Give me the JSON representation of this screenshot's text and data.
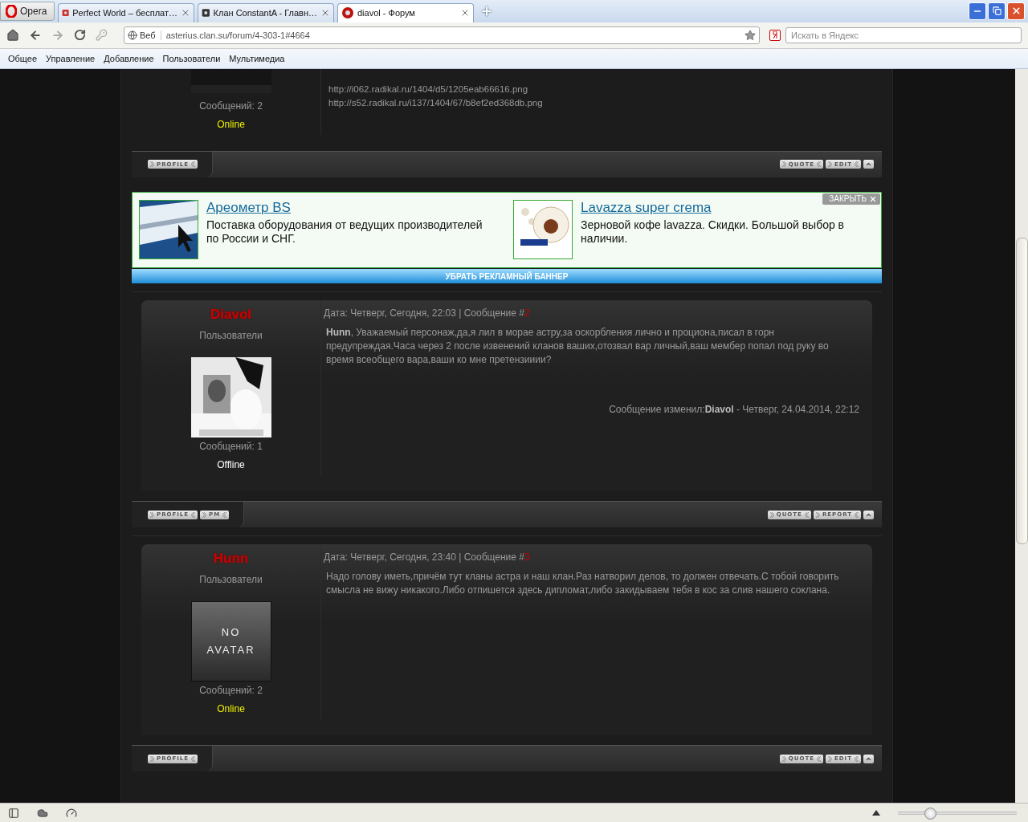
{
  "browser": {
    "opera_label": "Opera",
    "tabs": [
      {
        "title": "Perfect World – бесплат…",
        "selected": false,
        "kind": "game"
      },
      {
        "title": "Клан ConstantA - Главн…",
        "selected": false,
        "kind": "clan"
      },
      {
        "title": "diavol - Форум",
        "selected": true,
        "kind": "forum"
      }
    ],
    "address": {
      "badge": "Веб",
      "url": "asterius.clan.su/forum/4-303-1#4664"
    },
    "search": {
      "placeholder": "Искать в Яндекс"
    },
    "bookmarks": [
      "Общее",
      "Управление",
      "Добавление",
      "Пользователи",
      "Мультимедиа"
    ]
  },
  "posts": [
    {
      "kind": "partial",
      "count": "Сообщений: 2",
      "status": "Online",
      "online": true,
      "lines": [
        "http://i062.radikal.ru/1404/d5/1205eab66616.png",
        "http://s52.radikal.ru/i137/1404/67/b8ef2ed368db.png"
      ],
      "footer_left": [
        "PROFILE"
      ],
      "footer_right": [
        "QUOTE",
        "EDIT"
      ]
    },
    {
      "kind": "full",
      "author": "Diavol",
      "group": "Пользователи",
      "count": "Сообщений: 1",
      "status": "Offline",
      "online": false,
      "date": "Дата: Четверг, Сегодня, 22:03 | Сообщение #",
      "number": "2",
      "body": "**Hunn**, Уважаемый персонаж,да,я лил в морае астру,за оскорбления лично и проциона,писал в горн предупреждая.Часа через 2 после извенений кланов ваших,отозвал вар личный,ваш мембер попал под руку во время всеобщего вара,ваши ко мне претензииии?",
      "edit_note": "Сообщение изменил:**Diavol** - Четверг, 24.04.2014, 22:12",
      "footer_left": [
        "PROFILE",
        "PM"
      ],
      "footer_right": [
        "QUOTE",
        "REPORT"
      ]
    },
    {
      "kind": "full",
      "author": "Hunn",
      "group": "Пользователи",
      "avatar_label": "NO AVATAR",
      "count": "Сообщений: 2",
      "status": "Online",
      "online": true,
      "date": "Дата: Четверг, Сегодня, 23:40 | Сообщение #",
      "number": "3",
      "body": "Надо голову иметь,причём тут кланы астра и наш клан.Раз натворил делов, то должен отвечать.С тобой говорить смысла не вижу никакого.Либо отпишется здесь дипломат,либо закидываем тебя в кос за слив нашего соклана.",
      "footer_left": [
        "PROFILE"
      ],
      "footer_right": [
        "QUOTE",
        "EDIT"
      ]
    }
  ],
  "ads": {
    "close": "ЗАКРЫТЬ",
    "items": [
      {
        "title": "Ареометр BS",
        "text": "Поставка оборудования от ведущих производителей по России и СНГ."
      },
      {
        "title": "Lavazza super crema",
        "text": "Зерновой кофе lavazza. Скидки. Большой выбор в наличии."
      }
    ],
    "remove": "УБРАТЬ РЕКЛАМНЫЙ БАННЕР"
  },
  "status_bar": {
    "zoom": {
      "level": 0.27
    }
  }
}
